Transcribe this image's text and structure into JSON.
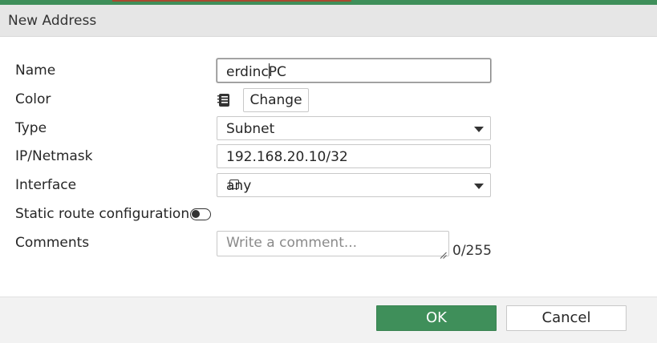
{
  "dialog": {
    "title": "New Address"
  },
  "form": {
    "name": {
      "label": "Name",
      "value_before_cursor": "erdinc",
      "value_after_cursor": "PC"
    },
    "color": {
      "label": "Color",
      "icon": "color-swatch-icon",
      "change_label": "Change"
    },
    "type": {
      "label": "Type",
      "value": "Subnet"
    },
    "ip_netmask": {
      "label": "IP/Netmask",
      "value": "192.168.20.10/32"
    },
    "interface": {
      "label": "Interface",
      "value": "any"
    },
    "static_route": {
      "label": "Static route configuration",
      "enabled": false
    },
    "comments": {
      "label": "Comments",
      "placeholder": "Write a comment...",
      "counter": "0/255"
    }
  },
  "buttons": {
    "ok": "OK",
    "cancel": "Cancel"
  },
  "colors": {
    "accent": "#3f8f5a",
    "header_bg": "#e6e6e6",
    "footer_bg": "#f2f2f2"
  }
}
